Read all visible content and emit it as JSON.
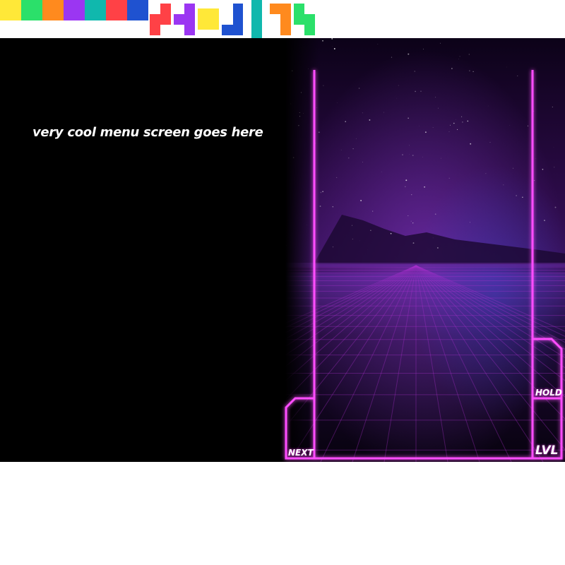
{
  "palette": {
    "swatches": [
      {
        "name": "yellow",
        "color": "#FFE838"
      },
      {
        "name": "green",
        "color": "#2BE06A"
      },
      {
        "name": "orange",
        "color": "#FF8A1E"
      },
      {
        "name": "purple",
        "color": "#9B36F2"
      },
      {
        "name": "teal",
        "color": "#10B8AD"
      },
      {
        "name": "red",
        "color": "#FF4146"
      },
      {
        "name": "blue",
        "color": "#1F52D0"
      }
    ],
    "tetrominoes": [
      {
        "name": "Z-piece-red",
        "color": "#FF4146"
      },
      {
        "name": "T-piece-purple",
        "color": "#9B36F2"
      },
      {
        "name": "O-piece-yellow",
        "color": "#FFE838"
      },
      {
        "name": "J-piece-blue",
        "color": "#1F52D0"
      },
      {
        "name": "I-piece-teal",
        "color": "#10B8AD"
      },
      {
        "name": "L-piece-orange",
        "color": "#FF8A1E"
      },
      {
        "name": "S-piece-green",
        "color": "#2BE06A"
      }
    ]
  },
  "menu": {
    "placeholder_text": "very cool menu screen goes here"
  },
  "hud": {
    "next_label": "NEXT",
    "hold_label": "HOLD",
    "level_label": "LVL",
    "neon_color": "#FF4DFF"
  },
  "background": {
    "theme": "synthwave-grid",
    "sky_color": "#1a0530",
    "grid_color": "#b030d0"
  }
}
